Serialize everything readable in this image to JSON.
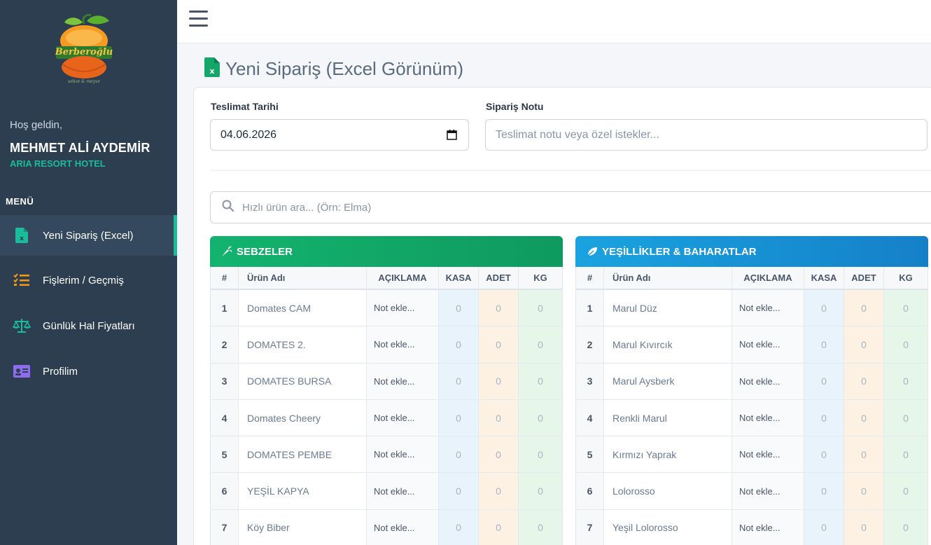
{
  "sidebar": {
    "logo_text": "Berberoğlu",
    "logo_tagline": "sebze & meyve",
    "welcome": "Hoş geldin,",
    "user_name": "MEHMET ALİ AYDEMİR",
    "hotel": "ARIA RESORT HOTEL",
    "menu_title": "MENÜ",
    "items": [
      {
        "label": "Yeni Sipariş (Excel)",
        "icon": "excel-file-icon",
        "active": true
      },
      {
        "label": "Fişlerim / Geçmiş",
        "icon": "list-check-icon",
        "active": false
      },
      {
        "label": "Günlük Hal Fiyatları",
        "icon": "scale-icon",
        "active": false
      },
      {
        "label": "Profilim",
        "icon": "id-card-icon",
        "active": false
      }
    ]
  },
  "page": {
    "title": "Yeni Sipariş (Excel Görünüm)"
  },
  "form": {
    "delivery_label": "Teslimat Tarihi",
    "delivery_value": "04.06.2026",
    "note_label": "Sipariş Notu",
    "note_placeholder": "Teslimat notu veya özel istekler...",
    "search_placeholder": "Hızlı ürün ara... (Örn: Elma)"
  },
  "columns": {
    "num": "#",
    "name": "Ürün Adı",
    "note": "AÇIKLAMA",
    "kasa": "KASA",
    "adet": "ADET",
    "kg": "KG"
  },
  "tables": [
    {
      "title": "SEBZELER",
      "color": "#13a86a",
      "rows": [
        {
          "num": "1",
          "name": "Domates CAM",
          "note": "Not ekle...",
          "kasa": "0",
          "adet": "0",
          "kg": "0"
        },
        {
          "num": "2",
          "name": "DOMATES 2.",
          "note": "Not ekle...",
          "kasa": "0",
          "adet": "0",
          "kg": "0"
        },
        {
          "num": "3",
          "name": "DOMATES BURSA",
          "note": "Not ekle...",
          "kasa": "0",
          "adet": "0",
          "kg": "0"
        },
        {
          "num": "4",
          "name": "Domates Cheery",
          "note": "Not ekle...",
          "kasa": "0",
          "adet": "0",
          "kg": "0"
        },
        {
          "num": "5",
          "name": "DOMATES PEMBE",
          "note": "Not ekle...",
          "kasa": "0",
          "adet": "0",
          "kg": "0"
        },
        {
          "num": "6",
          "name": "YEŞİL KAPYA",
          "note": "Not ekle...",
          "kasa": "0",
          "adet": "0",
          "kg": "0"
        },
        {
          "num": "7",
          "name": "Köy Biber",
          "note": "Not ekle...",
          "kasa": "0",
          "adet": "0",
          "kg": "0"
        }
      ]
    },
    {
      "title": "YEŞİLLİKLER & BAHARATLAR",
      "color": "#1a8fd8",
      "rows": [
        {
          "num": "1",
          "name": "Marul Düz",
          "note": "Not ekle...",
          "kasa": "0",
          "adet": "0",
          "kg": "0"
        },
        {
          "num": "2",
          "name": "Marul Kıvırcık",
          "note": "Not ekle...",
          "kasa": "0",
          "adet": "0",
          "kg": "0"
        },
        {
          "num": "3",
          "name": "Marul Aysberk",
          "note": "Not ekle...",
          "kasa": "0",
          "adet": "0",
          "kg": "0"
        },
        {
          "num": "4",
          "name": "Renkli Marul",
          "note": "Not ekle...",
          "kasa": "0",
          "adet": "0",
          "kg": "0"
        },
        {
          "num": "5",
          "name": "Kırmızı Yaprak",
          "note": "Not ekle...",
          "kasa": "0",
          "adet": "0",
          "kg": "0"
        },
        {
          "num": "6",
          "name": "Lolorosso",
          "note": "Not ekle...",
          "kasa": "0",
          "adet": "0",
          "kg": "0"
        },
        {
          "num": "7",
          "name": "Yeşil Lolorosso",
          "note": "Not ekle...",
          "kasa": "0",
          "adet": "0",
          "kg": "0"
        }
      ]
    }
  ]
}
